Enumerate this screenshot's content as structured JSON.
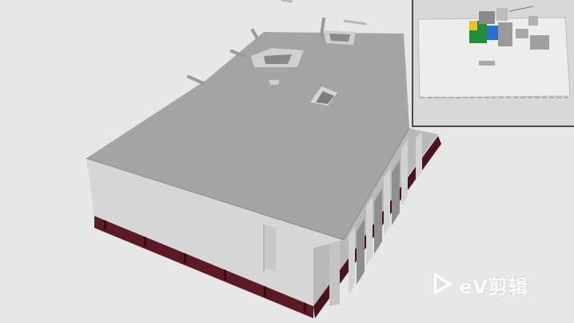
{
  "viewer": {
    "background_color": "#e8e8e8",
    "roof_color": "#a3a3a3",
    "wall_front_color": "#d4d4d4",
    "wall_side_color": "#c2c2c2",
    "foundation_color": "#5c1a24"
  },
  "minimap": {
    "icon": "map-overview-icon",
    "highlight_colors": [
      "#1f8f3a",
      "#f0c020",
      "#2a6fd0",
      "#9a9a9a"
    ]
  },
  "watermark": {
    "icon": "play-triangle-icon",
    "text": "eV剪辑"
  }
}
